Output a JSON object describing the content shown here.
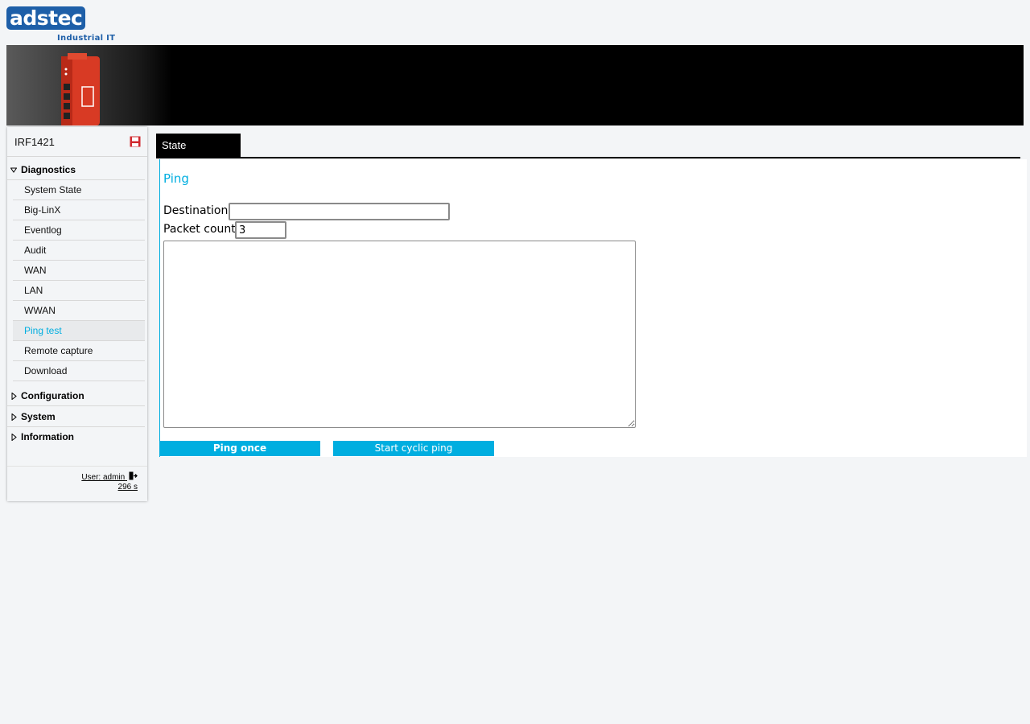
{
  "brand": {
    "logo_text": "adstec",
    "logo_sub": "Industrial IT"
  },
  "sidebar": {
    "device_name": "IRF1421",
    "sections": {
      "diagnostics": "Diagnostics",
      "configuration": "Configuration",
      "system": "System",
      "information": "Information"
    },
    "items": [
      {
        "label": "System State"
      },
      {
        "label": "Big-LinX"
      },
      {
        "label": "Eventlog"
      },
      {
        "label": "Audit"
      },
      {
        "label": "WAN"
      },
      {
        "label": "LAN"
      },
      {
        "label": "WWAN"
      },
      {
        "label": "Ping test"
      },
      {
        "label": "Remote capture"
      },
      {
        "label": "Download"
      }
    ],
    "active_item": "Ping test",
    "user": "User: admin",
    "session_timer": "296 s"
  },
  "tabs": [
    {
      "label": "State"
    }
  ],
  "ping": {
    "title": "Ping",
    "destination_label": "Destination",
    "destination_value": "",
    "packet_count_label": "Packet count",
    "packet_count_value": "3",
    "output": "",
    "ping_once_label": "Ping once",
    "cyclic_label": "Start cyclic ping"
  },
  "colors": {
    "accent": "#00aee0",
    "brand": "#1e5fa8",
    "tab_bg": "#000000",
    "save_icon": "#d0282e"
  }
}
